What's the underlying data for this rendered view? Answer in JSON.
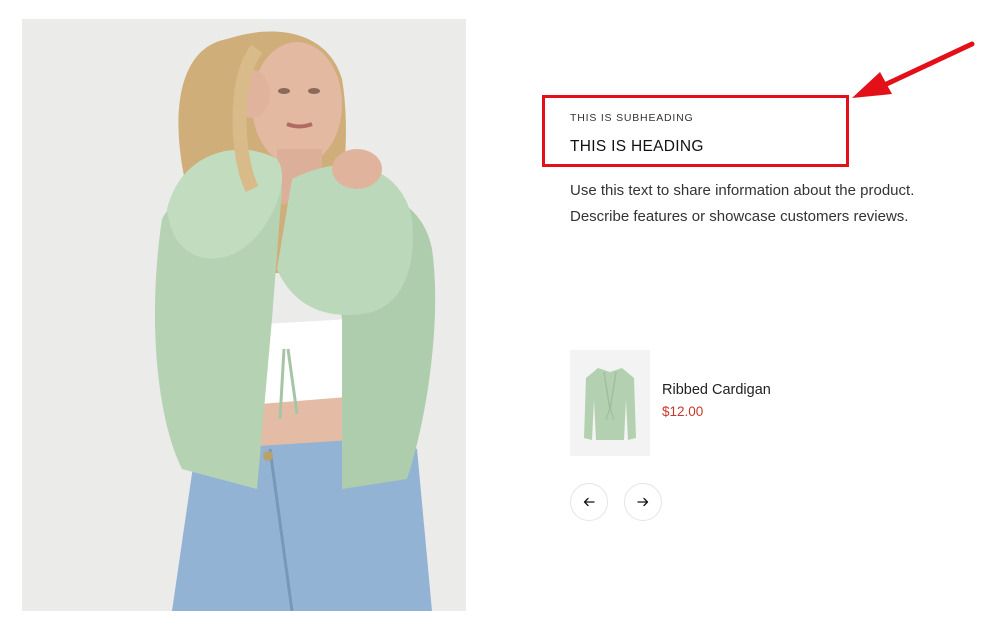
{
  "section": {
    "subheading": "THIS IS SUBHEADING",
    "heading": "THIS IS HEADING",
    "description": "Use this text to share information about the product. Describe features or showcase customers reviews."
  },
  "product": {
    "name": "Ribbed Cardigan",
    "price": "$12.00"
  },
  "navigation": {
    "prev_icon": "arrow-left-icon",
    "next_icon": "arrow-right-icon"
  },
  "annotation": {
    "color": "#e3101a"
  },
  "colors": {
    "price": "#c5382b",
    "cardigan": "#b6d3b4",
    "jeans": "#8fb0d0"
  }
}
